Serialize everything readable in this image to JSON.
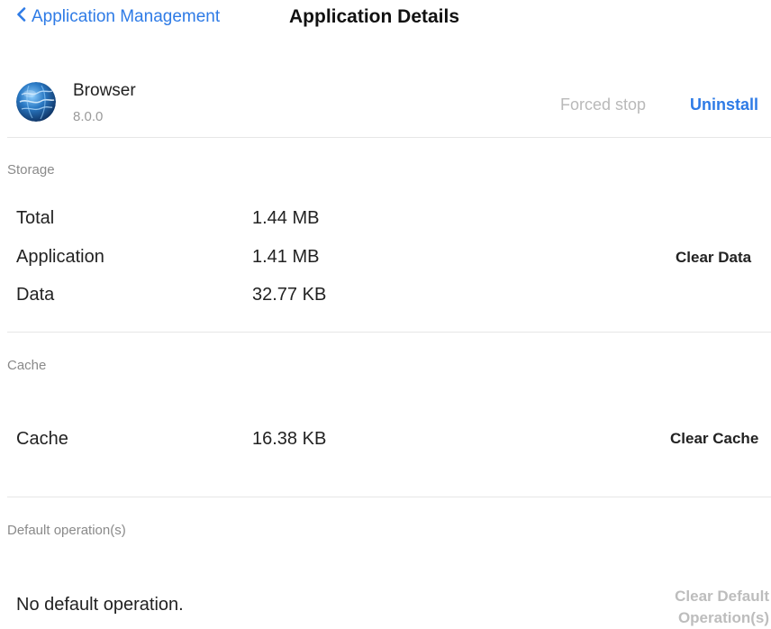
{
  "header": {
    "back_label": "Application Management",
    "title": "Application Details"
  },
  "app": {
    "name": "Browser",
    "version": "8.0.0",
    "icon": "globe-icon",
    "forced_stop_label": "Forced stop",
    "uninstall_label": "Uninstall"
  },
  "storage": {
    "section_label": "Storage",
    "rows": [
      {
        "label": "Total",
        "value": "1.44 MB"
      },
      {
        "label": "Application",
        "value": "1.41 MB"
      },
      {
        "label": "Data",
        "value": "32.77 KB"
      }
    ],
    "clear_label": "Clear Data"
  },
  "cache": {
    "section_label": "Cache",
    "label": "Cache",
    "value": "16.38 KB",
    "clear_label": "Clear Cache"
  },
  "defaults": {
    "section_label": "Default operation(s)",
    "status": "No default operation.",
    "clear_label_line1": "Clear Default",
    "clear_label_line2": "Operation(s)"
  },
  "colors": {
    "accent": "#2e7be6",
    "disabled": "#bdbdbd",
    "section": "#8a8a8a"
  }
}
